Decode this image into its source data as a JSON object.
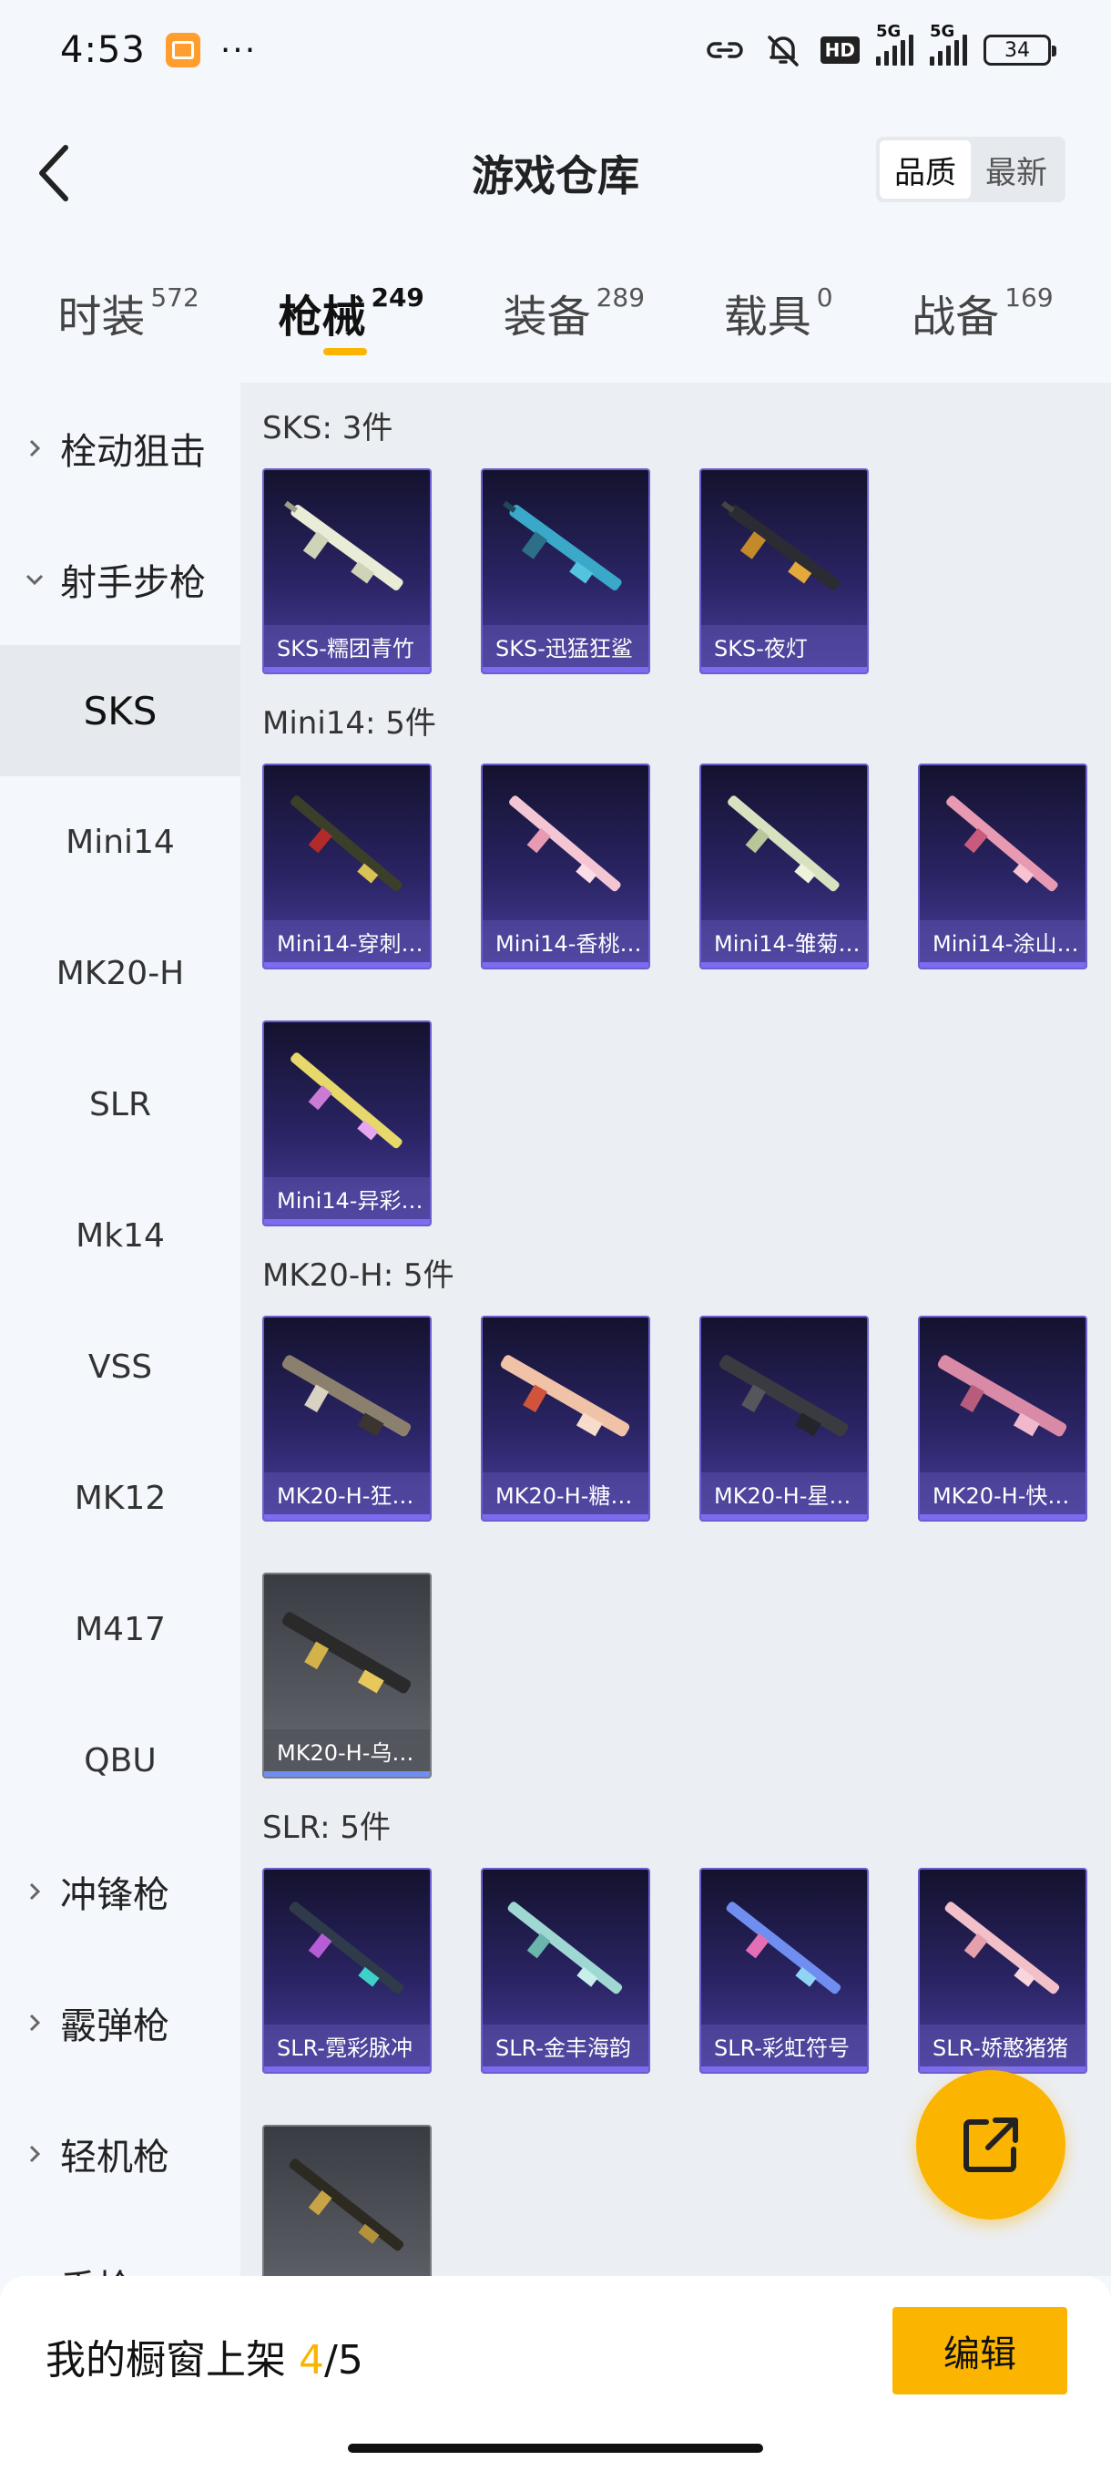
{
  "status": {
    "time": "4:53",
    "dots": "···",
    "battery": "34",
    "hd": "HD",
    "sig1": "5G",
    "sig2": "5G"
  },
  "header": {
    "title": "游戏仓库",
    "sort_quality": "品质",
    "sort_newest": "最新"
  },
  "tabs": [
    {
      "name": "时装",
      "count": "572"
    },
    {
      "name": "枪械",
      "count": "249"
    },
    {
      "name": "装备",
      "count": "289"
    },
    {
      "name": "载具",
      "count": "0"
    },
    {
      "name": "战备",
      "count": "169"
    }
  ],
  "sidebar": {
    "group_bolt": "栓动狙击",
    "group_marksman": "射手步枪",
    "subs": [
      "SKS",
      "Mini14",
      "MK20-H",
      "SLR",
      "Mk14",
      "VSS",
      "MK12",
      "M417",
      "QBU"
    ],
    "group_smg": "冲锋枪",
    "group_shotgun": "霰弹枪",
    "group_lmg": "轻机枪",
    "group_pistol": "手枪"
  },
  "sections": {
    "sks": {
      "title": "SKS: 3件",
      "items": [
        "SKS-糯团青竹",
        "SKS-迅猛狂鲨",
        "SKS-夜灯"
      ]
    },
    "mini14": {
      "title": "Mini14: 5件",
      "items": [
        "Mini14-穿刺…",
        "Mini14-香桃…",
        "Mini14-雏菊…",
        "Mini14-涂山…",
        "Mini14-异彩…"
      ]
    },
    "mk20h": {
      "title": "MK20-H: 5件",
      "items": [
        "MK20-H-狂…",
        "MK20-H-糖…",
        "MK20-H-星…",
        "MK20-H-快…",
        "MK20-H-乌…"
      ]
    },
    "slr": {
      "title": "SLR: 5件",
      "items": [
        "SLR-霓彩脉冲",
        "SLR-金丰海韵",
        "SLR-彩虹符号",
        "SLR-娇憨猪猪"
      ]
    }
  },
  "bottom": {
    "shelf_label": "我的橱窗上架 ",
    "shelf_current": "4",
    "shelf_sep": "/",
    "shelf_total": "5",
    "edit": "编辑"
  },
  "colors": {
    "accent": "#fbb400",
    "card_bg": "#2a2464",
    "card_border": "#6b5fd0"
  }
}
